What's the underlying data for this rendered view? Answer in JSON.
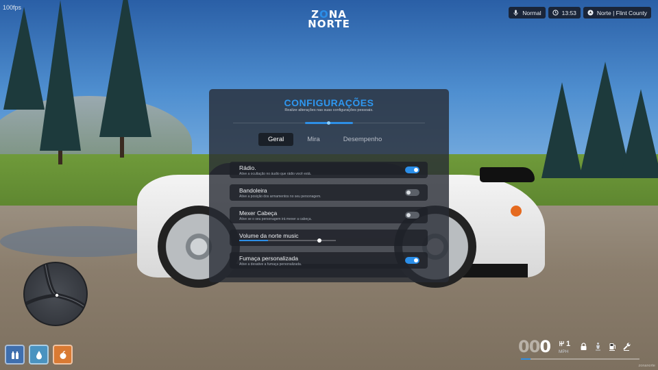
{
  "hud": {
    "fps": "100fps",
    "logo": {
      "line1_a": "Z",
      "line1_b": "O",
      "line1_c": "NA",
      "line2": "NORTE"
    },
    "status": [
      {
        "icon": "microphone-icon",
        "text": "Normal"
      },
      {
        "icon": "clock-icon",
        "text": "13:53"
      },
      {
        "icon": "location-icon",
        "text": "Norte | Flint County"
      }
    ],
    "footer": "zonanorte"
  },
  "settings": {
    "title": "CONFIGURAÇÕES",
    "subtitle": "Realize alterações nas suas configurações pessoais.",
    "tabs": [
      {
        "label": "Geral",
        "active": true
      },
      {
        "label": "Mira",
        "active": false
      },
      {
        "label": "Desempenho",
        "active": false
      }
    ],
    "options": [
      {
        "label": "Rádio.",
        "description": "Ative a ocultação no áudio que rádio você está.",
        "type": "toggle",
        "on": true
      },
      {
        "label": "Bandoleira",
        "description": "Ative a posição dos armamentos no seu personagem.",
        "type": "toggle",
        "on": false
      },
      {
        "label": "Mexer Cabeça",
        "description": "Ative se o seu personagem irá mexer a cabeça.",
        "type": "toggle",
        "on": false
      },
      {
        "label": "Volume da norte music",
        "description": "",
        "type": "slider",
        "value": 0.3,
        "marker": 0.83
      },
      {
        "label": "Fumaça personalizada",
        "description": "Ative a desative a fumaça personalizada.",
        "type": "toggle",
        "on": true
      }
    ]
  },
  "needs": [
    {
      "icon": "water-bottle-icon",
      "color": "#3f6fae"
    },
    {
      "icon": "water-drop-icon",
      "color": "#4a93c0"
    },
    {
      "icon": "food-apple-icon",
      "color": "#d97a33"
    }
  ],
  "vehicle": {
    "speed_dim": "00",
    "speed": "0",
    "gear": "1",
    "unit": "MPH",
    "speed_fraction": 0.08,
    "icons": [
      "lock-icon",
      "seatbelt-icon",
      "fuel-icon",
      "wrench-icon"
    ]
  },
  "colors": {
    "accent": "#2e8fe6",
    "panel": "#282c34"
  }
}
